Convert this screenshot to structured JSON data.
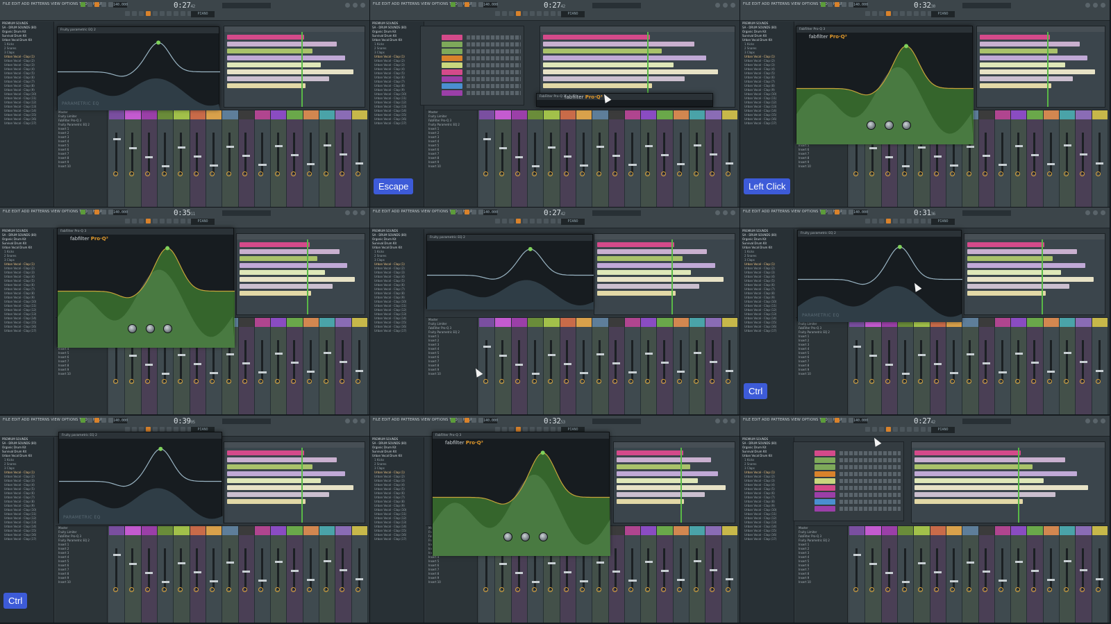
{
  "app": {
    "menu_text": "FILE EDIT ADD PATTERNS VIEW OPTIONS TOOLS HELP",
    "tempo": "140.000",
    "pattern": "PIANO"
  },
  "browser": {
    "items": [
      "PREMIUM SOUNDS",
      "SA - DRUM SOUNDS (80)",
      "Organic Drum Kit",
      "Survival Drum Kit",
      "Urban Vocal Drum Kit",
      "1 Kicks",
      "2 Snares",
      "3 Claps",
      "Urban Vocal - Clap (1)",
      "Urban Vocal - Clap (2)",
      "Urban Vocal - Clap (3)",
      "Urban Vocal - Clap (4)",
      "Urban Vocal - Clap (5)",
      "Urban Vocal - Clap (6)",
      "Urban Vocal - Clap (7)",
      "Urban Vocal - Clap (8)",
      "Urban Vocal - Clap (9)",
      "Urban Vocal - Clap (10)",
      "Urban Vocal - Clap (11)",
      "Urban Vocal - Clap (12)",
      "Urban Vocal - Clap (13)",
      "Urban Vocal - Clap (14)",
      "Urban Vocal - Clap (15)",
      "Urban Vocal - Clap (16)",
      "Urban Vocal - Clap (17)"
    ]
  },
  "mixer_inserts": [
    "Master",
    "Fruity Limiter",
    "FabFilter Pro-Q 3",
    "Fruity Parametric EQ 2",
    "Insert 1",
    "Insert 2",
    "Insert 3",
    "Insert 4",
    "Insert 5",
    "Insert 6",
    "Insert 7",
    "Insert 8",
    "Insert 9",
    "Insert 10"
  ],
  "panels": [
    {
      "timer": "0:27",
      "timer_sub": "42",
      "plugin": "Fruity parametric EQ 2",
      "plugin_label": "PARAMETRIC EQ",
      "brand_a": "",
      "brand_b": "",
      "overlay": ""
    },
    {
      "timer": "0:27",
      "timer_sub": "42",
      "plugin": "FabFilter Pro-Q 3",
      "plugin_label": "",
      "brand_a": "fabfilter",
      "brand_b": "Pro·Q³",
      "overlay": "Escape"
    },
    {
      "timer": "0:32",
      "timer_sub": "30",
      "plugin": "FabFilter Pro-Q 3",
      "plugin_label": "",
      "brand_a": "fabfilter",
      "brand_b": "Pro·Q³",
      "overlay": "Left Click"
    },
    {
      "timer": "0:35",
      "timer_sub": "11",
      "plugin": "FabFilter Pro-Q 3",
      "plugin_label": "",
      "brand_a": "fabfilter",
      "brand_b": "Pro·Q³",
      "overlay": ""
    },
    {
      "timer": "0:27",
      "timer_sub": "42",
      "plugin": "Fruity parametric EQ 2",
      "plugin_label": "",
      "brand_a": "",
      "brand_b": "",
      "overlay": ""
    },
    {
      "timer": "0:31",
      "timer_sub": "36",
      "plugin": "Fruity parametric EQ 2",
      "plugin_label": "PARAMETRIC EQ",
      "brand_a": "",
      "brand_b": "",
      "overlay": "Ctrl"
    },
    {
      "timer": "0:39",
      "timer_sub": "05",
      "plugin": "Fruity parametric EQ 2",
      "plugin_label": "PARAMETRIC EQ",
      "brand_a": "",
      "brand_b": "",
      "overlay": "Ctrl"
    },
    {
      "timer": "0:32",
      "timer_sub": "53",
      "plugin": "FabFilter Pro-Q 3",
      "plugin_label": "",
      "brand_a": "fabfilter",
      "brand_b": "Pro·Q³",
      "overlay": ""
    },
    {
      "timer": "0:27",
      "timer_sub": "42",
      "plugin": "",
      "plugin_label": "",
      "brand_a": "",
      "brand_b": "",
      "overlay": ""
    }
  ],
  "colors": {
    "accent_orange": "#d9822b",
    "overlay_blue": "#3d5bd8",
    "playhead_green": "#59b847",
    "strip_caps": [
      "#7a4fa0",
      "#c45bd0",
      "#9b3fa8",
      "#6a8c3a",
      "#a2c14a",
      "#c96b49",
      "#d9a14b",
      "#5e7e9a",
      "#3b3b3b",
      "#b0458f",
      "#8a4cc2",
      "#6aa84a",
      "#d28750",
      "#4aa3a8",
      "#8a6cb5",
      "#c7b84a"
    ]
  }
}
